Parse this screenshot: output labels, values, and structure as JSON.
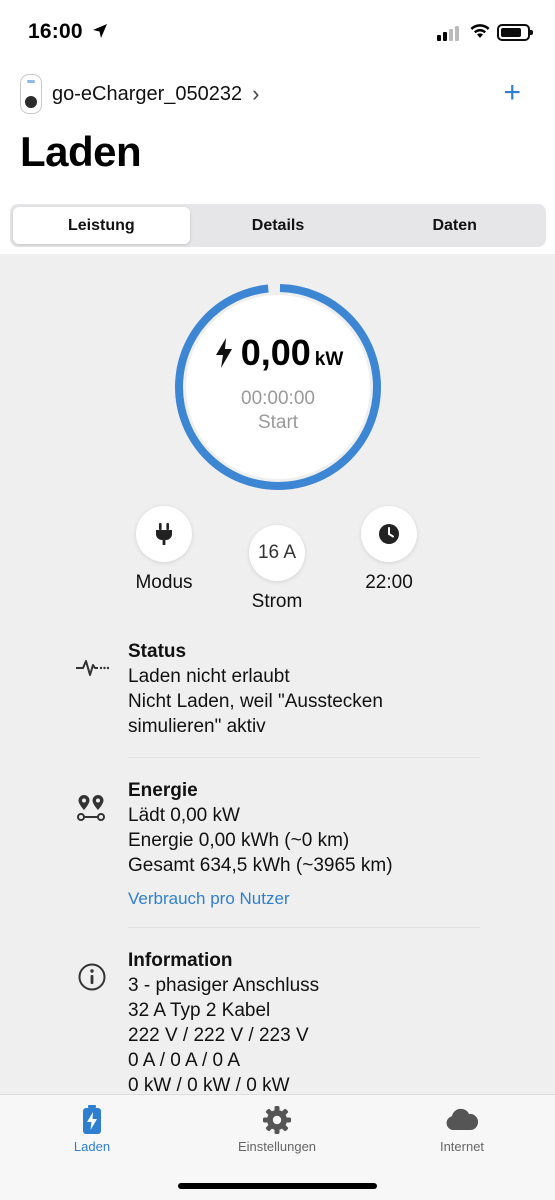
{
  "status_bar": {
    "time": "16:00"
  },
  "device": {
    "name": "go-eCharger_050232"
  },
  "page_title": "Laden",
  "segments": [
    {
      "label": "Leistung",
      "active": true
    },
    {
      "label": "Details",
      "active": false
    },
    {
      "label": "Daten",
      "active": false
    }
  ],
  "gauge": {
    "power_value": "0,00",
    "power_unit": "kW",
    "timer": "00:00:00",
    "start_label": "Start",
    "ring_color": "#3d86d3"
  },
  "controls": {
    "mode_label": "Modus",
    "ampere_value": "16 A",
    "ampere_label": "Strom",
    "time_label": "22:00"
  },
  "status": {
    "title": "Status",
    "lines": [
      "Laden nicht erlaubt",
      "Nicht Laden, weil \"Ausstecken simulieren\" aktiv"
    ]
  },
  "energy": {
    "title": "Energie",
    "lines": [
      "Lädt 0,00 kW",
      "Energie 0,00 kWh (~0 km)",
      "Gesamt 634,5 kWh (~3965 km)"
    ],
    "link": "Verbrauch pro Nutzer"
  },
  "information": {
    "title": "Information",
    "lines": [
      "3 - phasiger Anschluss",
      "32 A Typ 2 Kabel",
      "222 V / 222 V / 223 V",
      "0 A / 0 A / 0 A",
      "0 kW / 0 kW / 0 kW"
    ]
  },
  "tabbar": [
    {
      "label": "Laden",
      "icon": "battery-bolt-icon",
      "active": true
    },
    {
      "label": "Einstellungen",
      "icon": "gear-icon",
      "active": false
    },
    {
      "label": "Internet",
      "icon": "cloud-icon",
      "active": false
    }
  ],
  "colors": {
    "accent": "#2f7fd1",
    "background": "#efeff0"
  }
}
